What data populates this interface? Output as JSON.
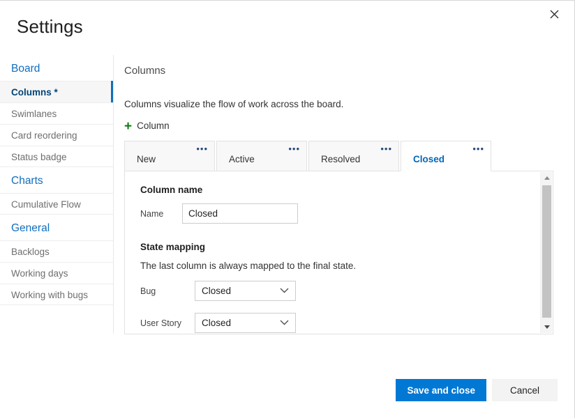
{
  "dialog": {
    "title": "Settings",
    "close_icon": "close-icon"
  },
  "sidebar": {
    "groups": [
      {
        "header": "Board",
        "items": [
          {
            "label": "Columns *",
            "selected": true
          },
          {
            "label": "Swimlanes",
            "selected": false
          },
          {
            "label": "Card reordering",
            "selected": false
          },
          {
            "label": "Status badge",
            "selected": false
          }
        ]
      },
      {
        "header": "Charts",
        "items": [
          {
            "label": "Cumulative Flow",
            "selected": false
          }
        ]
      },
      {
        "header": "General",
        "items": [
          {
            "label": "Backlogs",
            "selected": false
          },
          {
            "label": "Working days",
            "selected": false
          },
          {
            "label": "Working with bugs",
            "selected": false
          }
        ]
      }
    ]
  },
  "main": {
    "heading": "Columns",
    "description": "Columns visualize the flow of work across the board.",
    "add_column": {
      "plus": "+",
      "label": "Column"
    },
    "tabs": [
      {
        "label": "New",
        "active": false,
        "menu": "•••"
      },
      {
        "label": "Active",
        "active": false,
        "menu": "•••"
      },
      {
        "label": "Resolved",
        "active": false,
        "menu": "•••"
      },
      {
        "label": "Closed",
        "active": true,
        "menu": "•••"
      }
    ],
    "panel": {
      "column_name_title": "Column name",
      "name_label": "Name",
      "name_value": "Closed",
      "name_placeholder": "Column name",
      "state_mapping_title": "State mapping",
      "state_mapping_note": "The last column is always mapped to the final state.",
      "mappings": [
        {
          "label": "Bug",
          "value": "Closed"
        },
        {
          "label": "User Story",
          "value": "Closed"
        }
      ]
    }
  },
  "footer": {
    "save_label": "Save and close",
    "cancel_label": "Cancel"
  },
  "colors": {
    "accent": "#0078d4",
    "link": "#106ebe",
    "selected_text": "#004578",
    "active_tab_text": "#0067b8",
    "plus_green": "#107c10",
    "menu_dots": "#23487a"
  }
}
